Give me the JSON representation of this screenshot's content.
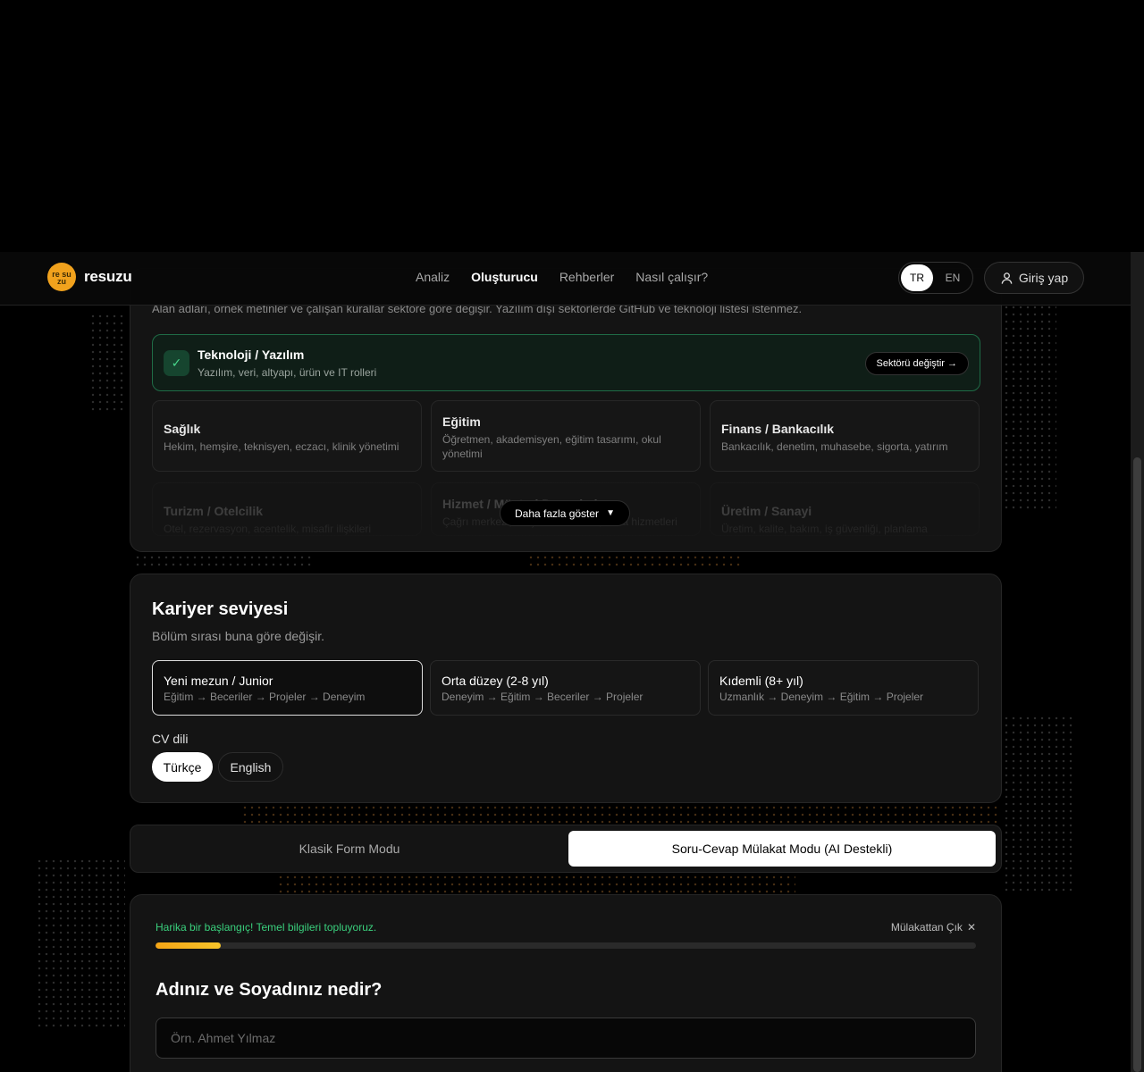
{
  "brand": {
    "logo_mark": "re su zu",
    "name": "resuzu",
    "accent": "#f1a21d"
  },
  "nav": {
    "items": [
      {
        "label": "Analiz",
        "active": false
      },
      {
        "label": "Oluşturucu",
        "active": true
      },
      {
        "label": "Rehberler",
        "active": false
      },
      {
        "label": "Nasıl çalışır?",
        "active": false
      }
    ]
  },
  "lang": {
    "tr": "TR",
    "en": "EN",
    "selected": "TR"
  },
  "login": {
    "label": "Giriş yap",
    "icon": "user-icon"
  },
  "sector": {
    "description": "Alan adları, örnek metinler ve çalışan kurallar sektöre göre değişir. Yazılım dışı sektörlerde GitHub ve teknoloji listesi istenmez.",
    "selected": {
      "title": "Teknoloji / Yazılım",
      "subtitle": "Yazılım, veri, altyapı, ürün ve IT rolleri",
      "change_label": "Sektörü değiştir →"
    },
    "cards": [
      {
        "title": "Sağlık",
        "subtitle": "Hekim, hemşire, teknisyen, eczacı, klinik yönetimi"
      },
      {
        "title": "Eğitim",
        "subtitle": "Öğretmen, akademisyen, eğitim tasarımı, okul yönetimi"
      },
      {
        "title": "Finans / Bankacılık",
        "subtitle": "Bankacılık, denetim, muhasebe, sigorta, yatırım"
      },
      {
        "title": "Turizm / Otelcilik",
        "subtitle": "Otel, rezervasyon, acentelik, misafir ilişkileri"
      },
      {
        "title": "Hizmet / Müşteri Deneyimi",
        "subtitle": "Çağrı merkezi, müşteri hizmetleri, saha hizmetleri"
      },
      {
        "title": "Üretim / Sanayi",
        "subtitle": "Üretim, kalite, bakım, iş güvenliği, planlama"
      }
    ],
    "more_label": "Daha fazla göster"
  },
  "career": {
    "title": "Kariyer seviyesi",
    "subtitle": "Bölüm sırası buna göre değişir.",
    "levels": [
      {
        "title": "Yeni mezun / Junior",
        "order": "Eğitim → Beceriler → Projeler → Deneyim",
        "selected": true
      },
      {
        "title": "Orta düzey (2-8 yıl)",
        "order": "Deneyim → Eğitim → Beceriler → Projeler",
        "selected": false
      },
      {
        "title": "Kıdemli (8+ yıl)",
        "order": "Uzmanlık → Deneyim → Eğitim → Projeler",
        "selected": false
      }
    ],
    "cv_label": "CV dili",
    "languages": [
      {
        "label": "Türkçe",
        "selected": true
      },
      {
        "label": "English",
        "selected": false
      }
    ]
  },
  "modes": {
    "classic": "Klasik Form Modu",
    "interview": "Soru-Cevap Mülakat Modu (AI Destekli)",
    "selected": "interview"
  },
  "interview": {
    "status": "Harika bir başlangıç! Temel bilgileri topluyoruz.",
    "exit_label": "Mülakattan Çık",
    "progress_percent": 8,
    "question": "Adınız ve Soyadınız nedir?",
    "placeholder": "Örn. Ahmet Yılmaz",
    "value": ""
  },
  "colors": {
    "success": "#3ad07d",
    "progress_start": "#f5a516",
    "progress_end": "#f7c42a"
  }
}
